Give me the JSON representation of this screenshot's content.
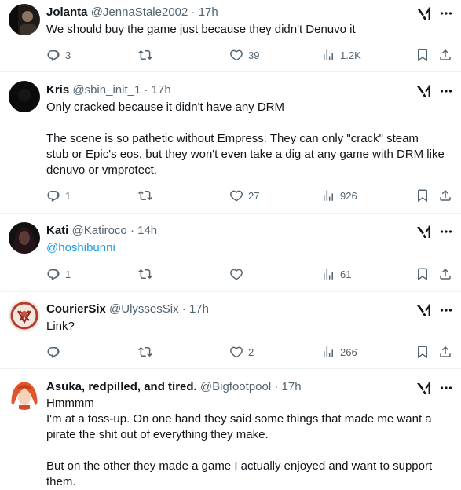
{
  "tweets": [
    {
      "name": "Jolanta",
      "handle": "@JennaStale2002",
      "dot": "·",
      "time": "17h",
      "lines": [
        "We should buy the game just because they didn't Denuvo it"
      ],
      "replies": "3",
      "reposts": "",
      "likes": "39",
      "views": "1.2K"
    },
    {
      "name": "Kris",
      "handle": "@sbin_init_1",
      "dot": "·",
      "time": "17h",
      "lines": [
        "Only cracked because it didn't have any DRM",
        "",
        "The scene is so pathetic without Empress. They can only \"crack\" steam",
        "stub or Epic's eos, but they won't even take a dig at any game with DRM like",
        "denuvo or vmprotect."
      ],
      "replies": "1",
      "reposts": "",
      "likes": "27",
      "views": "926"
    },
    {
      "name": "Kati",
      "handle": "@Katiroco",
      "dot": "·",
      "time": "14h",
      "mention": "@hoshibunni",
      "replies": "1",
      "reposts": "",
      "likes": "",
      "views": "61"
    },
    {
      "name": "CourierSix",
      "handle": "@UlyssesSix",
      "dot": "·",
      "time": "17h",
      "lines": [
        "Link?"
      ],
      "replies": "",
      "reposts": "",
      "likes": "2",
      "views": "266"
    },
    {
      "name": "Asuka, redpilled, and tired.",
      "handle": "@Bigfootpool",
      "dot": "·",
      "time": "17h",
      "lines": [
        "Hmmmm",
        "I'm at a toss-up. On one hand they said some things that made me want a",
        "pirate the shit out of everything they make.",
        "",
        "But on the other they made a game I actually enjoyed and want to support",
        "them."
      ]
    }
  ],
  "colors": {
    "text": "#0f1419",
    "muted": "#536471",
    "link": "#1d9bf0",
    "divider": "#eff3f4"
  },
  "icons": [
    "reply-icon",
    "repost-icon",
    "like-icon",
    "views-icon",
    "bookmark-icon",
    "share-icon",
    "grok-icon",
    "more-icon"
  ]
}
